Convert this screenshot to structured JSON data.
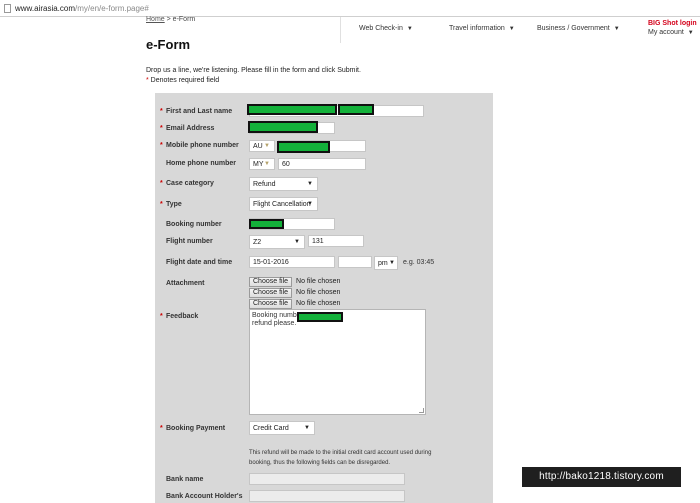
{
  "browser": {
    "url_host": "www.airasia.com",
    "url_path": "/my/en/e-form.page#"
  },
  "breadcrumb": {
    "home": "Home",
    "separator": " > ",
    "current": "e-Form"
  },
  "nav": {
    "web_checkin": "Web Check-in",
    "travel_info": "Travel information",
    "business_gov": "Business / Government",
    "caret": "▼",
    "bigshot": "BIG Shot login",
    "my_account": "My account"
  },
  "page": {
    "title": "e-Form",
    "intro": "Drop us a line, we're listening. Please fill in the form and click Submit.",
    "required_star": "*",
    "required_note": " Denotes required field"
  },
  "form": {
    "name_label": "First and Last name",
    "email_label": "Email Address",
    "mobile_label": "Mobile phone number",
    "mobile_country": "AU",
    "home_label": "Home phone number",
    "home_country": "MY",
    "home_code": "60",
    "case_label": "Case category",
    "case_value": "Refund",
    "type_label": "Type",
    "type_value": "Flight Cancellation",
    "booking_label": "Booking number",
    "flight_label": "Flight number",
    "flight_carrier": "Z2",
    "flight_number": "131",
    "date_label": "Flight date and time",
    "date_value": "15-01-2016",
    "ampm_value": "pm",
    "time_example": "e.g. 03:45",
    "attachment_label": "Attachment",
    "choose_file": "Choose file",
    "no_file": "No file chosen",
    "feedback_label": "Feedback",
    "feedback_line1": "Booking number",
    "feedback_line2": "refund please.",
    "payment_label": "Booking Payment",
    "payment_value": "Credit Card",
    "refund_note": "This refund will be made to the initial credit card account used during booking, thus the following fields can be disregarded.",
    "bank_name_label": "Bank name",
    "bank_holder_label": "Bank Account Holder's"
  },
  "watermark": "http://bako1218.tistory.com",
  "colors": {
    "redaction": "#13b13a",
    "required": "#cc0000",
    "brand_red": "#d4001a",
    "panel": "#d8d8d8"
  }
}
